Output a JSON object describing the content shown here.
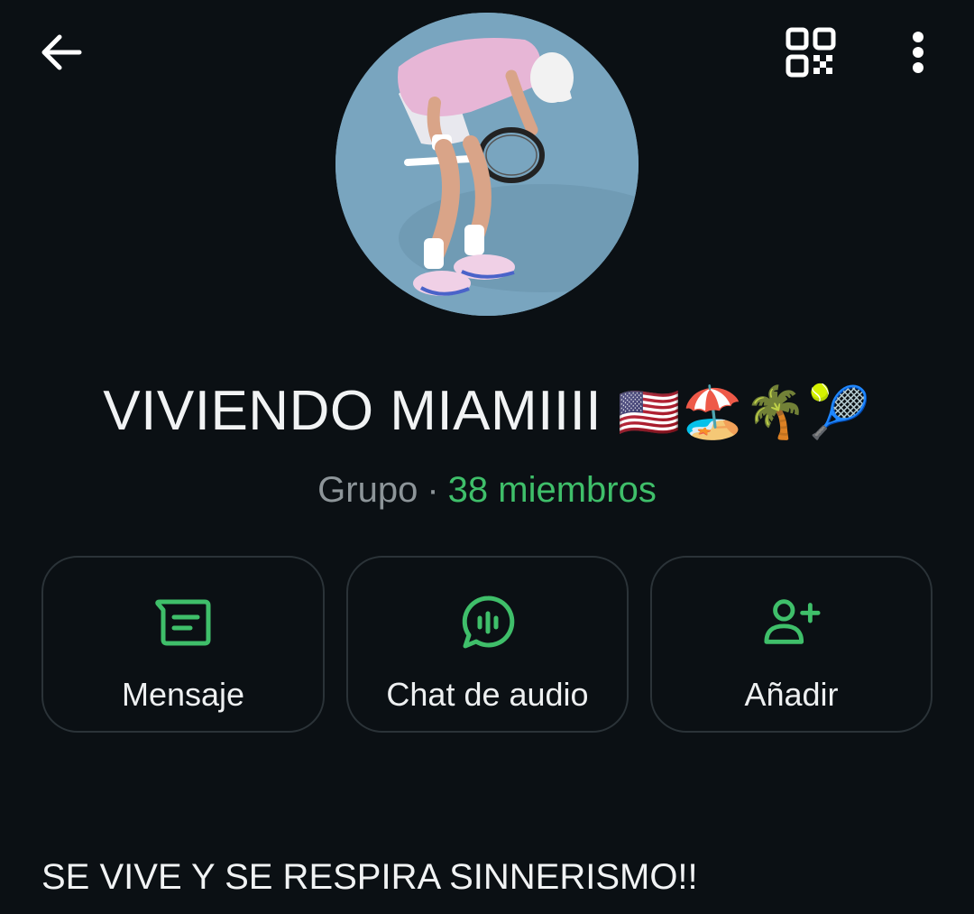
{
  "header": {
    "back_icon": "arrow-left-icon",
    "qr_icon": "qr-code-icon",
    "more_icon": "more-vertical-icon"
  },
  "profile": {
    "name": "VIVIENDO MIAMIIII",
    "name_emojis": "🇺🇸🏖️🌴🎾",
    "type": "Grupo",
    "separator": "·",
    "members": "38 miembros"
  },
  "actions": [
    {
      "label": "Mensaje",
      "icon": "message-icon"
    },
    {
      "label": "Chat de audio",
      "icon": "audio-chat-icon"
    },
    {
      "label": "Añadir",
      "icon": "add-person-icon"
    }
  ],
  "description": "SE VIVE Y SE RESPIRA SINNERISMO!!",
  "colors": {
    "background": "#0b1014",
    "accent": "#3fbf6a",
    "text": "#f1f3f4",
    "muted": "#8d9599",
    "card_border": "#2b3338"
  }
}
